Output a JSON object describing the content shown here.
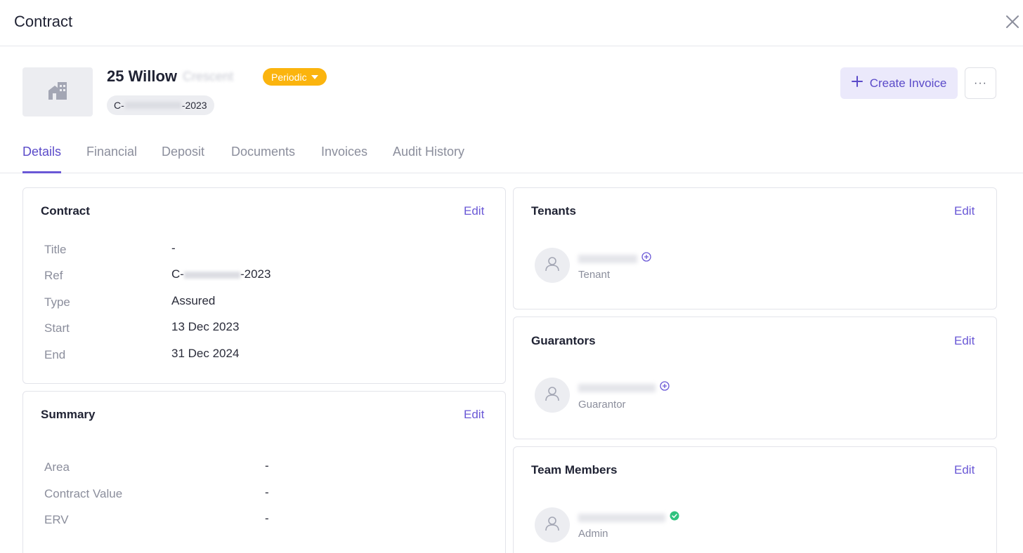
{
  "header": {
    "title": "Contract"
  },
  "property": {
    "name": "25 Willow",
    "name_suffix": "Crescent",
    "status": "Periodic",
    "ref_prefix": "C-",
    "ref_suffix": "-2023"
  },
  "actions": {
    "create_invoice_label": "Create Invoice",
    "more_label": "···"
  },
  "tabs": [
    {
      "label": "Details"
    },
    {
      "label": "Financial"
    },
    {
      "label": "Deposit"
    },
    {
      "label": "Documents"
    },
    {
      "label": "Invoices"
    },
    {
      "label": "Audit History"
    }
  ],
  "contract_card": {
    "title": "Contract",
    "edit_label": "Edit",
    "rows": [
      {
        "label": "Title",
        "value": "-"
      },
      {
        "label": "Ref",
        "value_prefix": "C-",
        "value_suffix": "-2023"
      },
      {
        "label": "Type",
        "value": "Assured"
      },
      {
        "label": "Start",
        "value": "13 Dec 2023"
      },
      {
        "label": "End",
        "value": "31 Dec 2024"
      }
    ]
  },
  "summary_card": {
    "title": "Summary",
    "edit_label": "Edit",
    "rows": [
      {
        "label": "Area",
        "value": "-"
      },
      {
        "label": "Contract Value",
        "value": "-"
      },
      {
        "label": "ERV",
        "value": "-"
      }
    ]
  },
  "tenants_card": {
    "title": "Tenants",
    "edit_label": "Edit",
    "person_role": "Tenant"
  },
  "guarantors_card": {
    "title": "Guarantors",
    "edit_label": "Edit",
    "person_role": "Guarantor"
  },
  "team_card": {
    "title": "Team Members",
    "edit_label": "Edit",
    "person_role": "Admin"
  },
  "colors": {
    "accent": "#6a58d6",
    "status": "#fbb40e",
    "verified": "#2ec27e"
  }
}
